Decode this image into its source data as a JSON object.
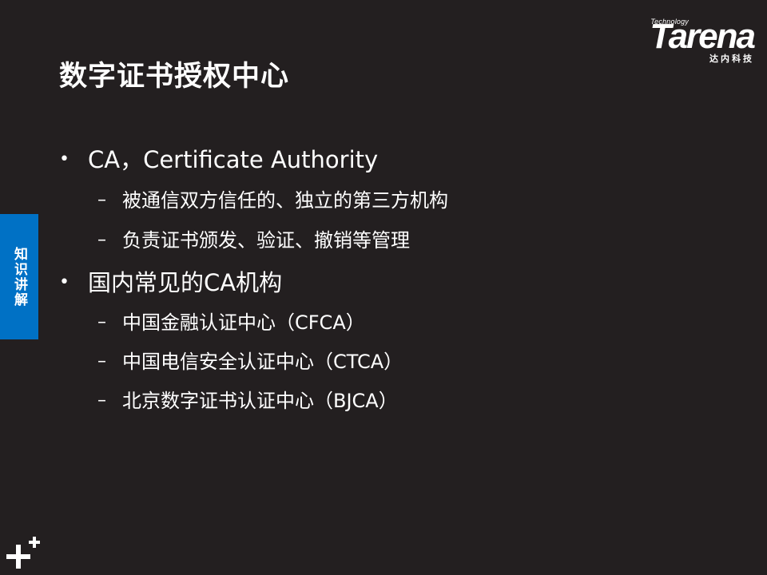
{
  "logo": {
    "technology": "Technology",
    "wordmark": "Tarena",
    "chinese": "达内科技"
  },
  "title": "数字证书授权中心",
  "side_tab": "知识讲解",
  "bullets": [
    {
      "marker": "•",
      "text": "CA，Certificate Authority",
      "children": [
        {
          "marker": "–",
          "text": "被通信双方信任的、独立的第三方机构"
        },
        {
          "marker": "–",
          "text": "负责证书颁发、验证、撤销等管理"
        }
      ]
    },
    {
      "marker": "•",
      "text": "国内常见的CA机构",
      "children": [
        {
          "marker": "–",
          "text": "中国金融认证中心（CFCA）"
        },
        {
          "marker": "–",
          "text": "中国电信安全认证中心（CTCA）"
        },
        {
          "marker": "–",
          "text": "北京数字证书认证中心（BJCA）"
        }
      ]
    }
  ],
  "colors": {
    "background": "#231f20",
    "side_tab": "#0071c5",
    "text": "#ffffff"
  },
  "icons": {
    "bottom_left": "plus-cluster-icon"
  }
}
